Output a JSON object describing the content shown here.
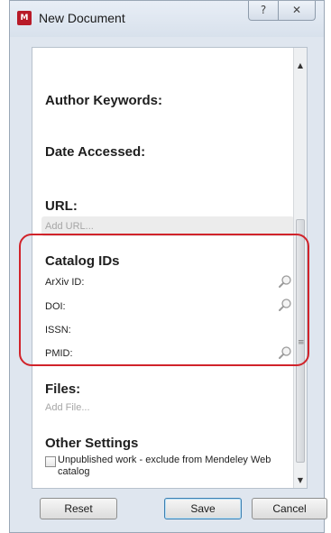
{
  "window": {
    "title": "New Document",
    "help_glyph": "?",
    "close_glyph": "✕",
    "app_icon_text": "M"
  },
  "form": {
    "author_keywords_label": "Author Keywords:",
    "date_accessed_label": "Date Accessed:",
    "url_label": "URL:",
    "url_placeholder": "Add URL...",
    "catalog_ids": {
      "heading": "Catalog IDs",
      "arxiv_label": "ArXiv ID:",
      "doi_label": "DOI:",
      "issn_label": "ISSN:",
      "pmid_label": "PMID:"
    },
    "files_heading": "Files:",
    "add_file_placeholder": "Add File...",
    "other_settings_heading": "Other Settings",
    "unpublished_label": "Unpublished work - exclude from Mendeley Web catalog",
    "unpublished_checked": false
  },
  "buttons": {
    "reset": "Reset",
    "save": "Save",
    "cancel": "Cancel"
  },
  "icons": {
    "lookup": "magnifier-icon",
    "scroll_up": "▲",
    "scroll_down": "▼",
    "grip": "≡"
  },
  "colors": {
    "highlight": "#d1232a",
    "app_icon": "#b81a28"
  }
}
